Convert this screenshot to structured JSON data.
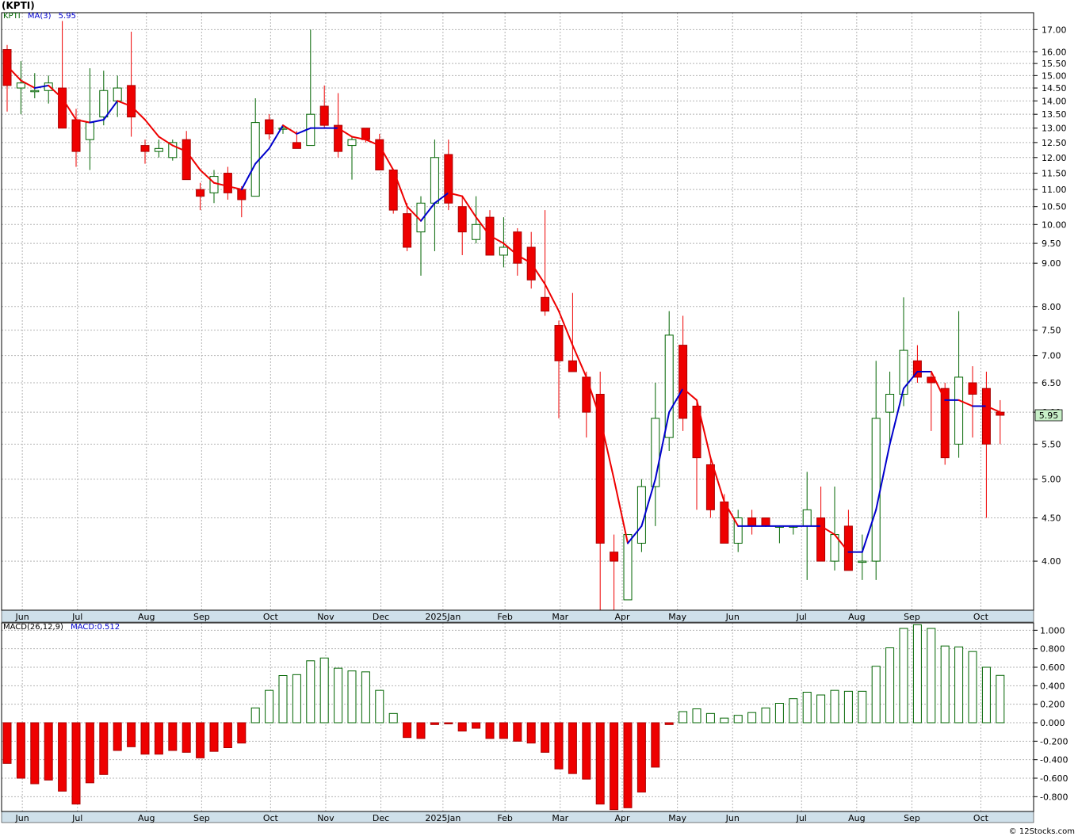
{
  "title": "(KPTI)",
  "price_legend": {
    "symbol": "KPTI",
    "ma_label": "MA(3)",
    "last_value": "5.95"
  },
  "macd_legend": {
    "label": "MACD(26,12,9)",
    "value_label": "MACD:0.512"
  },
  "last_price_tag": "5.95",
  "watermark": "© 12Stocks.com",
  "colors": {
    "up": "#006400",
    "down": "#ee0000",
    "ma_up": "#0000cc",
    "ma_down": "#ee0000",
    "grid": "#b4b4b4",
    "axis_band": "#cfe0ea",
    "price_tag_bg": "#c8f0c8"
  },
  "chart_data": [
    {
      "type": "candlestick",
      "scale": "log",
      "ylim": [
        3.5,
        17.8
      ],
      "yticks": [
        "4.00",
        "4.50",
        "5.00",
        "5.50",
        "6.00",
        "6.50",
        "7.00",
        "7.50",
        "8.00",
        "9.00",
        "9.50",
        "10.00",
        "10.50",
        "11.00",
        "11.50",
        "12.00",
        "12.50",
        "13.00",
        "13.50",
        "14.00",
        "14.50",
        "15.00",
        "15.50",
        "16.00",
        "17.00"
      ],
      "month_labels": [
        "Jun",
        "Jul",
        "Aug",
        "Sep",
        "Oct",
        "Nov",
        "Dec",
        "2025Jan",
        "Feb",
        "Mar",
        "Apr",
        "May",
        "Jun",
        "Jul",
        "Aug",
        "Sep",
        "Oct"
      ],
      "month_positions": [
        1.1,
        5.1,
        10.1,
        14.1,
        19.1,
        23.1,
        27.1,
        31.6,
        36.1,
        40.1,
        44.6,
        48.6,
        52.6,
        57.6,
        61.6,
        65.6,
        70.6
      ],
      "ohlc": [
        [
          16.1,
          16.3,
          13.6,
          14.6
        ],
        [
          14.5,
          15.6,
          13.5,
          14.7
        ],
        [
          14.4,
          15.1,
          14.1,
          14.4
        ],
        [
          14.4,
          15.0,
          13.9,
          14.7
        ],
        [
          14.5,
          17.4,
          13.0,
          13.0
        ],
        [
          13.3,
          13.7,
          11.7,
          12.2
        ],
        [
          12.6,
          15.3,
          11.6,
          13.2
        ],
        [
          13.4,
          15.2,
          13.1,
          14.4
        ],
        [
          14.0,
          15.0,
          13.4,
          14.5
        ],
        [
          14.6,
          16.9,
          12.7,
          13.4
        ],
        [
          12.4,
          12.6,
          11.8,
          12.2
        ],
        [
          12.2,
          12.6,
          12.0,
          12.3
        ],
        [
          12.0,
          12.6,
          11.9,
          12.5
        ],
        [
          12.6,
          12.9,
          11.3,
          11.3
        ],
        [
          11.0,
          11.2,
          10.4,
          10.8
        ],
        [
          10.9,
          11.6,
          10.6,
          11.4
        ],
        [
          11.5,
          11.7,
          10.7,
          10.9
        ],
        [
          11.0,
          11.1,
          10.2,
          10.7
        ],
        [
          10.8,
          14.1,
          10.8,
          13.2
        ],
        [
          13.3,
          13.5,
          12.6,
          12.8
        ],
        [
          13.0,
          13.1,
          12.8,
          13.0
        ],
        [
          12.5,
          12.9,
          12.3,
          12.3
        ],
        [
          12.4,
          17.0,
          12.4,
          13.5
        ],
        [
          13.8,
          14.6,
          13.0,
          13.1
        ],
        [
          13.1,
          14.3,
          12.0,
          12.2
        ],
        [
          12.4,
          12.7,
          11.3,
          12.6
        ],
        [
          13.0,
          13.0,
          12.5,
          12.6
        ],
        [
          12.6,
          12.8,
          11.6,
          11.6
        ],
        [
          11.6,
          11.6,
          10.3,
          10.4
        ],
        [
          10.3,
          10.6,
          9.3,
          9.4
        ],
        [
          9.8,
          10.8,
          8.7,
          10.6
        ],
        [
          10.6,
          12.6,
          9.3,
          12.0
        ],
        [
          12.1,
          12.6,
          10.4,
          10.6
        ],
        [
          10.5,
          10.8,
          9.2,
          9.8
        ],
        [
          9.6,
          10.8,
          9.5,
          10.0
        ],
        [
          10.2,
          10.4,
          9.2,
          9.2
        ],
        [
          9.2,
          10.2,
          8.9,
          9.4
        ],
        [
          9.8,
          9.9,
          8.7,
          9.0
        ],
        [
          9.4,
          9.8,
          8.4,
          8.6
        ],
        [
          8.2,
          10.4,
          7.8,
          7.9
        ],
        [
          7.6,
          7.7,
          5.9,
          6.9
        ],
        [
          6.9,
          8.3,
          6.7,
          6.7
        ],
        [
          6.6,
          6.7,
          5.6,
          6.0
        ],
        [
          6.3,
          6.7,
          3.4,
          4.2
        ],
        [
          4.1,
          4.3,
          3.5,
          4.0
        ],
        [
          3.6,
          4.3,
          3.6,
          4.3
        ],
        [
          4.2,
          5.0,
          4.1,
          4.9
        ],
        [
          4.9,
          6.5,
          4.4,
          5.9
        ],
        [
          5.6,
          7.9,
          5.4,
          7.4
        ],
        [
          7.2,
          7.8,
          5.7,
          5.9
        ],
        [
          6.1,
          6.2,
          4.6,
          5.3
        ],
        [
          5.2,
          5.3,
          4.5,
          4.6
        ],
        [
          4.7,
          4.8,
          4.2,
          4.2
        ],
        [
          4.2,
          4.6,
          4.1,
          4.5
        ],
        [
          4.5,
          4.6,
          4.3,
          4.4
        ],
        [
          4.5,
          4.5,
          4.4,
          4.4
        ],
        [
          4.4,
          4.4,
          4.2,
          4.4
        ],
        [
          4.4,
          4.4,
          4.3,
          4.4
        ],
        [
          4.4,
          5.1,
          3.8,
          4.6
        ],
        [
          4.5,
          4.9,
          4.0,
          4.0
        ],
        [
          4.0,
          4.9,
          3.9,
          4.3
        ],
        [
          4.4,
          4.6,
          3.9,
          3.9
        ],
        [
          4.0,
          4.3,
          3.8,
          4.0
        ],
        [
          4.0,
          6.9,
          3.8,
          5.9
        ],
        [
          6.0,
          6.7,
          5.5,
          6.3
        ],
        [
          6.3,
          8.2,
          6.1,
          7.1
        ],
        [
          6.9,
          7.2,
          6.5,
          6.6
        ],
        [
          6.6,
          6.7,
          5.7,
          6.5
        ],
        [
          6.4,
          6.5,
          5.2,
          5.3
        ],
        [
          5.5,
          7.9,
          5.3,
          6.6
        ],
        [
          6.5,
          6.8,
          5.6,
          6.3
        ],
        [
          6.4,
          6.7,
          4.5,
          5.5
        ],
        [
          6.0,
          6.2,
          5.5,
          5.95
        ]
      ],
      "ma3": [
        15.4,
        14.8,
        14.5,
        14.6,
        14.1,
        13.3,
        13.2,
        13.3,
        14.0,
        13.8,
        13.3,
        12.7,
        12.4,
        12.2,
        11.6,
        11.2,
        11.1,
        11.0,
        11.8,
        12.3,
        13.1,
        12.8,
        13.0,
        13.0,
        13.0,
        12.7,
        12.6,
        12.4,
        11.6,
        10.5,
        10.1,
        10.6,
        10.9,
        10.8,
        10.2,
        9.7,
        9.5,
        9.2,
        9.0,
        8.5,
        7.9,
        7.2,
        6.6,
        5.9,
        5.0,
        4.2,
        4.4,
        5.0,
        6.0,
        6.4,
        6.2,
        5.3,
        4.7,
        4.4,
        4.4,
        4.4,
        4.4,
        4.4,
        4.4,
        4.4,
        4.3,
        4.1,
        4.1,
        4.6,
        5.5,
        6.4,
        6.7,
        6.7,
        6.2,
        6.2,
        6.1,
        6.1,
        6.0
      ]
    },
    {
      "type": "bar",
      "series_label": "MACD(26,12,9)",
      "ylim": [
        -0.96,
        1.08
      ],
      "yticks": [
        "1.000",
        "0.800",
        "0.600",
        "0.400",
        "0.200",
        "0.000",
        "-0.200",
        "-0.400",
        "-0.600",
        "-0.800"
      ],
      "values": [
        -0.44,
        -0.6,
        -0.66,
        -0.62,
        -0.74,
        -0.88,
        -0.65,
        -0.56,
        -0.3,
        -0.26,
        -0.34,
        -0.34,
        -0.3,
        -0.32,
        -0.38,
        -0.31,
        -0.27,
        -0.22,
        0.16,
        0.35,
        0.51,
        0.52,
        0.67,
        0.7,
        0.59,
        0.56,
        0.55,
        0.35,
        0.1,
        -0.16,
        -0.17,
        -0.02,
        -0.01,
        -0.09,
        -0.06,
        -0.17,
        -0.17,
        -0.2,
        -0.22,
        -0.32,
        -0.5,
        -0.55,
        -0.61,
        -0.88,
        -0.94,
        -0.92,
        -0.75,
        -0.48,
        -0.02,
        0.12,
        0.15,
        0.1,
        0.05,
        0.08,
        0.11,
        0.16,
        0.21,
        0.26,
        0.33,
        0.3,
        0.35,
        0.34,
        0.34,
        0.61,
        0.81,
        1.02,
        1.06,
        1.02,
        0.83,
        0.82,
        0.77,
        0.6,
        0.512
      ]
    }
  ]
}
